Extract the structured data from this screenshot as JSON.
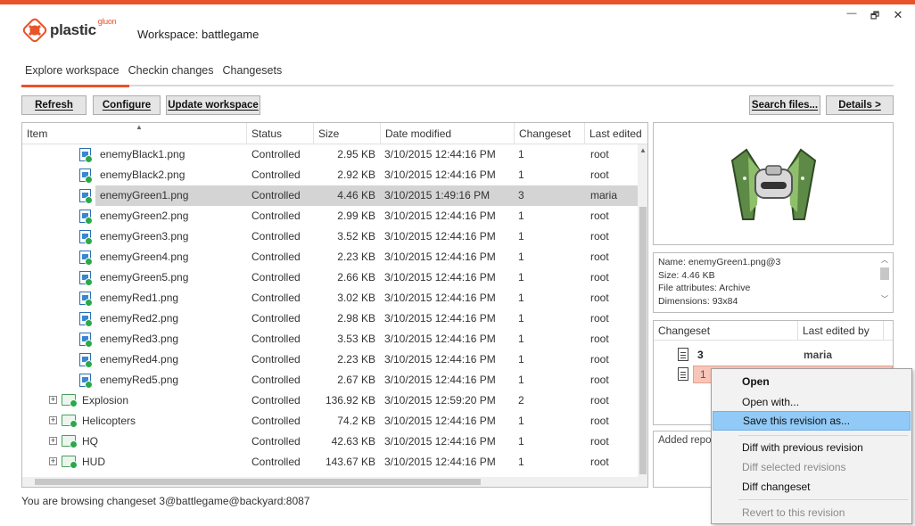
{
  "window": {
    "brand": "plastic",
    "brand_suffix": "gluon",
    "workspace_title": "Workspace: battlegame",
    "controls": {
      "minimize": "—",
      "maximize": "🗗",
      "close": "✕"
    },
    "accent_color": "#e8532a"
  },
  "tabs": [
    {
      "label": "Explore workspace",
      "active": true
    },
    {
      "label": "Checkin changes",
      "active": false
    },
    {
      "label": "Changesets",
      "active": false
    }
  ],
  "toolbar": {
    "refresh": "Refresh",
    "configure": "Configure",
    "update_workspace": "Update workspace",
    "search_files": "Search files...",
    "details": "Details >"
  },
  "grid": {
    "columns": [
      "Item",
      "Status",
      "Size",
      "Date modified",
      "Changeset",
      "Last edited"
    ],
    "rows": [
      {
        "type": "file",
        "name": "enemyBlack1.png",
        "status": "Controlled",
        "size": "2.95 KB",
        "date": "3/10/2015 12:44:16 PM",
        "changeset": "1",
        "user": "root"
      },
      {
        "type": "file",
        "name": "enemyBlack2.png",
        "status": "Controlled",
        "size": "2.92 KB",
        "date": "3/10/2015 12:44:16 PM",
        "changeset": "1",
        "user": "root"
      },
      {
        "type": "file",
        "name": "enemyGreen1.png",
        "status": "Controlled",
        "size": "4.46 KB",
        "date": "3/10/2015 1:49:16 PM",
        "changeset": "3",
        "user": "maria",
        "selected": true
      },
      {
        "type": "file",
        "name": "enemyGreen2.png",
        "status": "Controlled",
        "size": "2.99 KB",
        "date": "3/10/2015 12:44:16 PM",
        "changeset": "1",
        "user": "root"
      },
      {
        "type": "file",
        "name": "enemyGreen3.png",
        "status": "Controlled",
        "size": "3.52 KB",
        "date": "3/10/2015 12:44:16 PM",
        "changeset": "1",
        "user": "root"
      },
      {
        "type": "file",
        "name": "enemyGreen4.png",
        "status": "Controlled",
        "size": "2.23 KB",
        "date": "3/10/2015 12:44:16 PM",
        "changeset": "1",
        "user": "root"
      },
      {
        "type": "file",
        "name": "enemyGreen5.png",
        "status": "Controlled",
        "size": "2.66 KB",
        "date": "3/10/2015 12:44:16 PM",
        "changeset": "1",
        "user": "root"
      },
      {
        "type": "file",
        "name": "enemyRed1.png",
        "status": "Controlled",
        "size": "3.02 KB",
        "date": "3/10/2015 12:44:16 PM",
        "changeset": "1",
        "user": "root"
      },
      {
        "type": "file",
        "name": "enemyRed2.png",
        "status": "Controlled",
        "size": "2.98 KB",
        "date": "3/10/2015 12:44:16 PM",
        "changeset": "1",
        "user": "root"
      },
      {
        "type": "file",
        "name": "enemyRed3.png",
        "status": "Controlled",
        "size": "3.53 KB",
        "date": "3/10/2015 12:44:16 PM",
        "changeset": "1",
        "user": "root"
      },
      {
        "type": "file",
        "name": "enemyRed4.png",
        "status": "Controlled",
        "size": "2.23 KB",
        "date": "3/10/2015 12:44:16 PM",
        "changeset": "1",
        "user": "root"
      },
      {
        "type": "file",
        "name": "enemyRed5.png",
        "status": "Controlled",
        "size": "2.67 KB",
        "date": "3/10/2015 12:44:16 PM",
        "changeset": "1",
        "user": "root"
      },
      {
        "type": "folder",
        "name": "Explosion",
        "status": "Controlled",
        "size": "136.92 KB",
        "date": "3/10/2015 12:59:20 PM",
        "changeset": "2",
        "user": "root"
      },
      {
        "type": "folder",
        "name": "Helicopters",
        "status": "Controlled",
        "size": "74.2 KB",
        "date": "3/10/2015 12:44:16 PM",
        "changeset": "1",
        "user": "root"
      },
      {
        "type": "folder",
        "name": "HQ",
        "status": "Controlled",
        "size": "42.63 KB",
        "date": "3/10/2015 12:44:16 PM",
        "changeset": "1",
        "user": "root"
      },
      {
        "type": "folder",
        "name": "HUD",
        "status": "Controlled",
        "size": "143.67 KB",
        "date": "3/10/2015 12:44:16 PM",
        "changeset": "1",
        "user": "root"
      }
    ]
  },
  "info": {
    "lines": [
      "Name: enemyGreen1.png@3",
      "Size: 4.46 KB",
      "File attributes: Archive",
      "Dimensions: 93x84"
    ]
  },
  "history": {
    "columns": [
      "Changeset",
      "Last edited by"
    ],
    "rows": [
      {
        "changeset": "3",
        "user": "maria"
      },
      {
        "changeset": "1",
        "user": "",
        "highlighted": true
      }
    ]
  },
  "comments": {
    "label": "Added repo"
  },
  "status": "You are browsing changeset 3@battlegame@backyard:8087",
  "context_menu": {
    "open": "Open",
    "open_with": "Open with...",
    "save_revision": "Save this revision as...",
    "diff_previous": "Diff with previous revision",
    "diff_selected": "Diff selected revisions",
    "diff_changeset": "Diff changeset",
    "revert": "Revert to this revision"
  }
}
